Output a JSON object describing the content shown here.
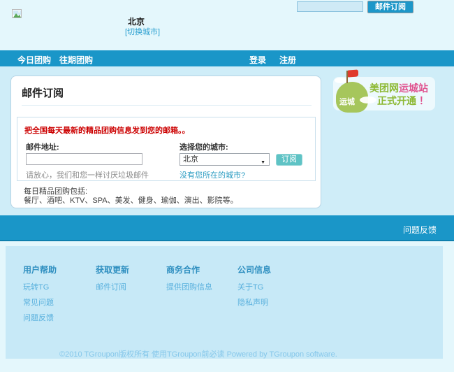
{
  "header": {
    "city": "北京",
    "switch_city": "[切换城市]",
    "search_value": "",
    "subscribe_button": "邮件订阅"
  },
  "nav": {
    "today": "今日团购",
    "past": "往期团购",
    "login": "登录",
    "register": "注册"
  },
  "subscribe_card": {
    "title": "邮件订阅",
    "promo": "把全国每天最新的精品团购信息发到您的邮箱。。",
    "email_label": "邮件地址:",
    "email_value": "",
    "email_hint": "请放心，我们和您一样讨厌垃圾邮件",
    "city_label": "选择您的城市:",
    "city_selected": "北京",
    "dropdown_arrow": "▼",
    "subscribe_button": "订阅",
    "no_city_link": "没有您所在的城市?",
    "daily_title": "每日精品团购包括:",
    "daily_list": "餐厅、酒吧、KTV、SPA、美发、健身、瑜伽、演出、影院等。"
  },
  "promo_badge": {
    "ribbon_label": "运城",
    "line1_green": "美团网",
    "line1_pink": "运城站",
    "line2_green": "正式开通",
    "line2_pink": " ！"
  },
  "feedback_bar": {
    "label": "问题反馈"
  },
  "footer": {
    "columns": [
      {
        "title": "用户帮助",
        "links": [
          "玩转TG",
          "常见问题",
          "问题反馈"
        ]
      },
      {
        "title": "获取更新",
        "links": [
          "邮件订阅"
        ]
      },
      {
        "title": "商务合作",
        "links": [
          "提供团购信息"
        ]
      },
      {
        "title": "公司信息",
        "links": [
          "关于TG",
          "隐私声明"
        ]
      }
    ],
    "copyright": "©2010 TGroupon版权所有 使用TGroupon前必读 Powered by TGroupon software."
  },
  "colors": {
    "accent_blue": "#1a96c8",
    "teal_button": "#5fc3c5",
    "promo_red": "#cc0000",
    "badge_green": "#8cb832",
    "badge_pink": "#e0538f",
    "link_blue": "#2a9fd0"
  }
}
